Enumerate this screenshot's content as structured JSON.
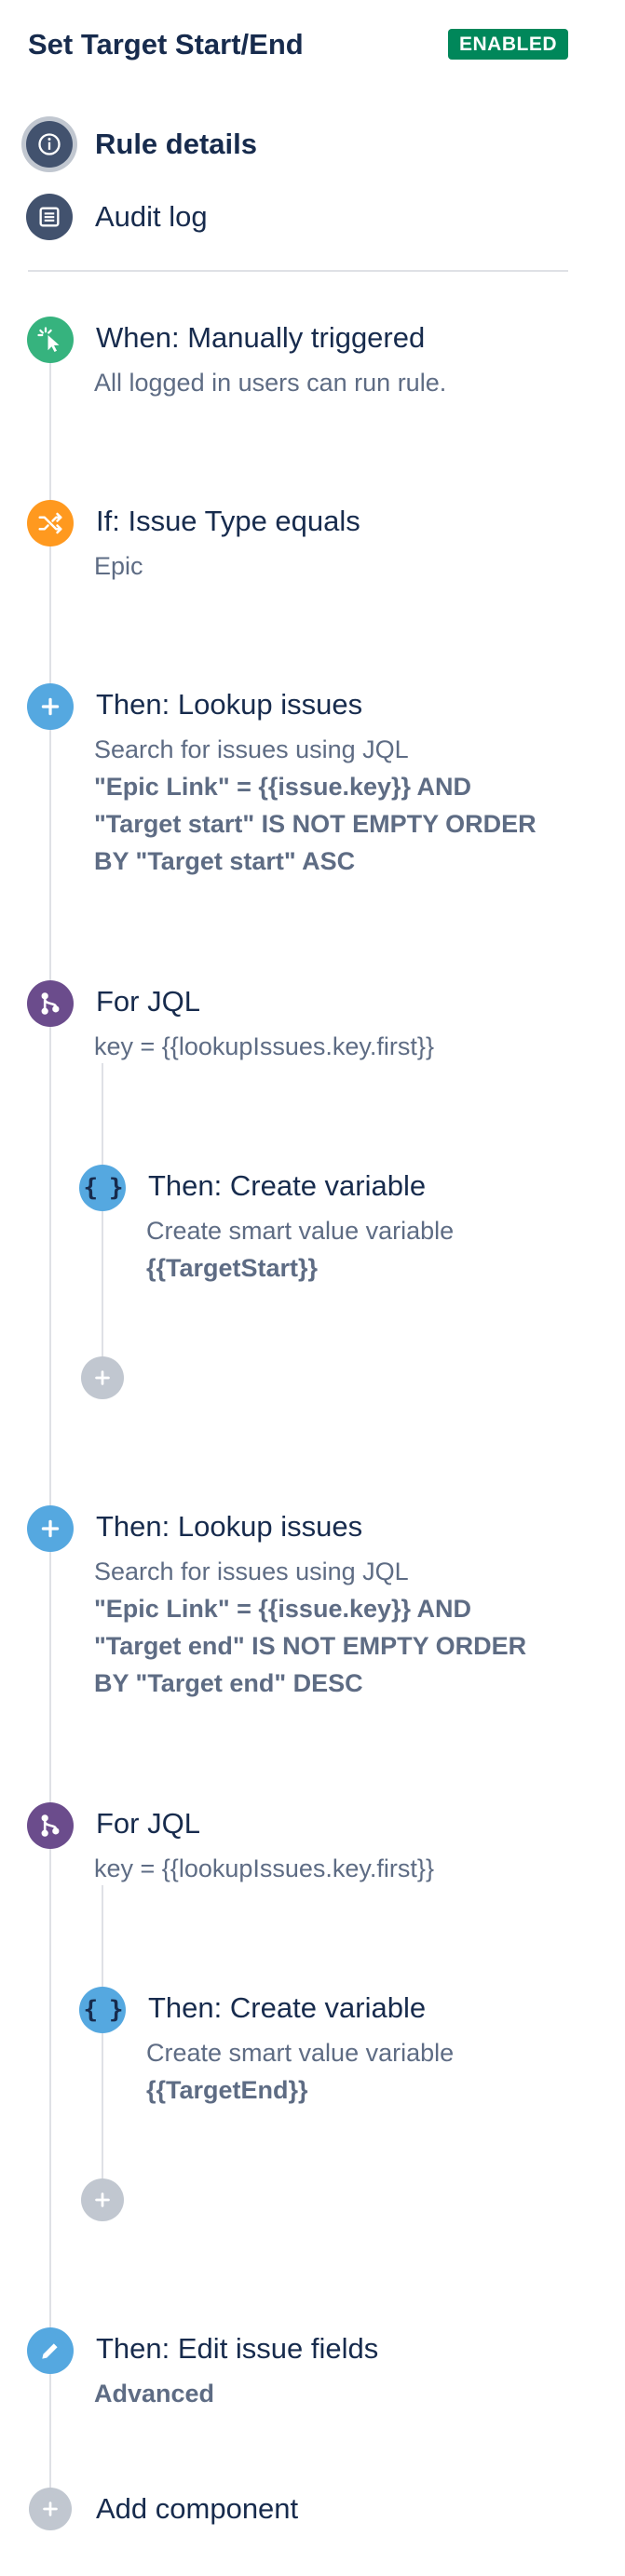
{
  "rule": {
    "title": "Set Target Start/End",
    "status": "ENABLED"
  },
  "nav": {
    "rule_details": "Rule details",
    "audit_log": "Audit log"
  },
  "components": {
    "trigger": {
      "title": "When: Manually triggered",
      "description": "All logged in users can run rule."
    },
    "condition": {
      "title": "If: Issue Type equals",
      "description": "Epic"
    },
    "lookup1": {
      "title": "Then: Lookup issues",
      "description": "Search for issues using JQL",
      "jql": [
        "\"Epic Link\" = {{issue.key}} AND",
        "\"Target start\" IS NOT EMPTY ORDER",
        "BY \"Target start\" ASC"
      ]
    },
    "branch1": {
      "title": "For JQL",
      "description": "key = {{lookupIssues.key.first}}",
      "variable": {
        "title": "Then: Create variable",
        "description": "Create smart value variable",
        "name": "{{TargetStart}}"
      }
    },
    "lookup2": {
      "title": "Then: Lookup issues",
      "description": "Search for issues using JQL",
      "jql": [
        "\"Epic Link\" = {{issue.key}} AND",
        "\"Target end\" IS NOT EMPTY ORDER",
        "BY \"Target end\" DESC"
      ]
    },
    "branch2": {
      "title": "For JQL",
      "description": "key = {{lookupIssues.key.first}}",
      "variable": {
        "title": "Then: Create variable",
        "description": "Create smart value variable",
        "name": "{{TargetEnd}}"
      }
    },
    "edit": {
      "title": "Then: Edit issue fields",
      "description": "Advanced"
    },
    "add_component": "Add component"
  },
  "icons": {
    "info": "info-icon",
    "audit": "list-icon",
    "trigger": "cursor-click-icon",
    "condition": "shuffle-icon",
    "action": "plus-icon",
    "branch": "branch-icon",
    "variable": "curly-braces-icon",
    "edit": "pencil-icon",
    "add": "plus-icon"
  },
  "colors": {
    "enabled_badge": "#00875a",
    "trigger": "#36b37e",
    "condition": "#ff991f",
    "action": "#55a8e0",
    "branch": "#6b4c8c",
    "add": "#c1c7d0",
    "nav_icon": "#42526e"
  }
}
